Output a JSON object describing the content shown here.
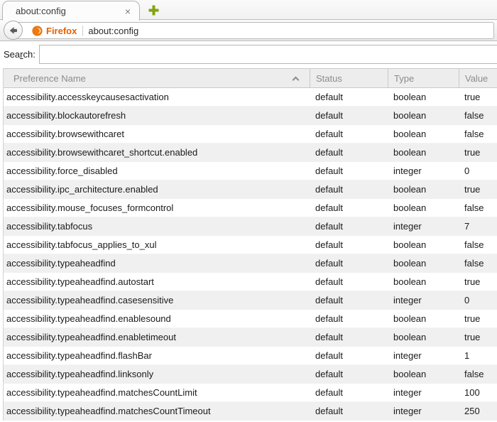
{
  "tabbar": {
    "tab_title": "about:config",
    "close_glyph": "×",
    "new_tab_icon": "plus-icon"
  },
  "nav": {
    "back_icon": "back-arrow-icon",
    "identity_icon": "firefox-icon",
    "identity_label": "Firefox",
    "url": "about:config"
  },
  "search": {
    "label_pre": "Sea",
    "label_accesskey": "r",
    "label_post": "ch:",
    "value": "",
    "placeholder": ""
  },
  "table": {
    "columns": [
      "Preference Name",
      "Status",
      "Type",
      "Value"
    ],
    "sort": {
      "column": "Preference Name",
      "direction": "ascending"
    },
    "rows": [
      {
        "name": "accessibility.accesskeycausesactivation",
        "status": "default",
        "type": "boolean",
        "value": "true"
      },
      {
        "name": "accessibility.blockautorefresh",
        "status": "default",
        "type": "boolean",
        "value": "false"
      },
      {
        "name": "accessibility.browsewithcaret",
        "status": "default",
        "type": "boolean",
        "value": "false"
      },
      {
        "name": "accessibility.browsewithcaret_shortcut.enabled",
        "status": "default",
        "type": "boolean",
        "value": "true"
      },
      {
        "name": "accessibility.force_disabled",
        "status": "default",
        "type": "integer",
        "value": "0"
      },
      {
        "name": "accessibility.ipc_architecture.enabled",
        "status": "default",
        "type": "boolean",
        "value": "true"
      },
      {
        "name": "accessibility.mouse_focuses_formcontrol",
        "status": "default",
        "type": "boolean",
        "value": "false"
      },
      {
        "name": "accessibility.tabfocus",
        "status": "default",
        "type": "integer",
        "value": "7"
      },
      {
        "name": "accessibility.tabfocus_applies_to_xul",
        "status": "default",
        "type": "boolean",
        "value": "false"
      },
      {
        "name": "accessibility.typeaheadfind",
        "status": "default",
        "type": "boolean",
        "value": "false"
      },
      {
        "name": "accessibility.typeaheadfind.autostart",
        "status": "default",
        "type": "boolean",
        "value": "true"
      },
      {
        "name": "accessibility.typeaheadfind.casesensitive",
        "status": "default",
        "type": "integer",
        "value": "0"
      },
      {
        "name": "accessibility.typeaheadfind.enablesound",
        "status": "default",
        "type": "boolean",
        "value": "true"
      },
      {
        "name": "accessibility.typeaheadfind.enabletimeout",
        "status": "default",
        "type": "boolean",
        "value": "true"
      },
      {
        "name": "accessibility.typeaheadfind.flashBar",
        "status": "default",
        "type": "integer",
        "value": "1"
      },
      {
        "name": "accessibility.typeaheadfind.linksonly",
        "status": "default",
        "type": "boolean",
        "value": "false"
      },
      {
        "name": "accessibility.typeaheadfind.matchesCountLimit",
        "status": "default",
        "type": "integer",
        "value": "100"
      },
      {
        "name": "accessibility.typeaheadfind.matchesCountTimeout",
        "status": "default",
        "type": "integer",
        "value": "250"
      }
    ]
  },
  "colors": {
    "firefox_orange": "#e66000",
    "firefox_icon_orange": "#f0780c",
    "new_tab_green": "#84a40e",
    "header_text": "#8c8c8c",
    "row_stripe": "#f0f0f0"
  }
}
